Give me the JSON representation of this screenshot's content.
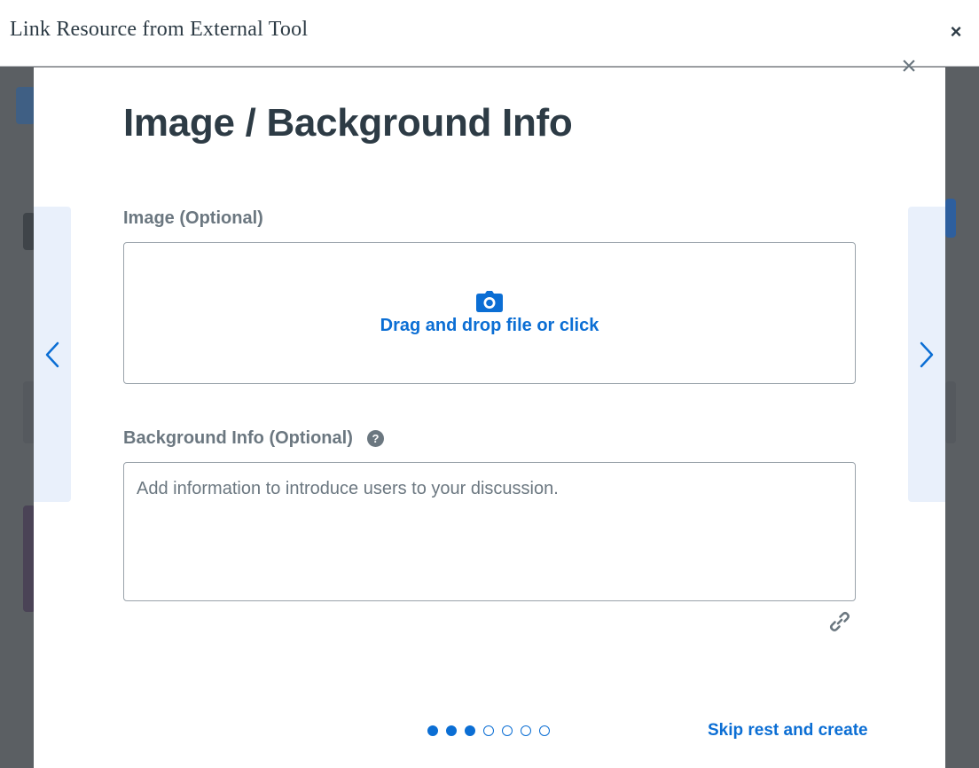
{
  "window": {
    "title": "Link Resource from External Tool",
    "close_label": "×"
  },
  "modal": {
    "close_label": "×",
    "title": "Image / Background Info",
    "image_field": {
      "label": "Image (Optional)",
      "dropzone_text": "Drag and drop file or click",
      "icon": "camera-icon"
    },
    "background_field": {
      "label": "Background Info (Optional)",
      "help_icon": "?",
      "placeholder": "Add information to introduce users to your discussion.",
      "value": ""
    },
    "link_icon": "link-icon",
    "pager": {
      "total_steps": 7,
      "completed_steps": 3
    },
    "skip_label": "Skip rest and create"
  },
  "colors": {
    "accent": "#0b6ed4",
    "text_dark": "#2d3b45",
    "text_muted": "#6b7780",
    "nav_panel": "#e9f0fb",
    "overlay": "#5b5f63"
  }
}
